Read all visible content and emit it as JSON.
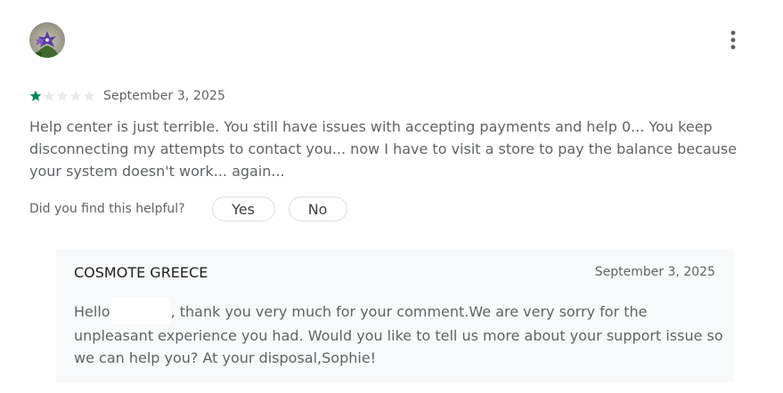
{
  "review": {
    "rating": 1,
    "rating_max": 5,
    "date": "September 3, 2025",
    "text": "Help center is just terrible. You still have issues with accepting payments and help 0... You keep disconnecting my attempts to contact you... now I have to visit a store to pay the balance because your system doesn't work... again...",
    "avatar_icon": "purple-flower-avatar",
    "menu_icon": "more-vert-icon"
  },
  "helpful": {
    "question": "Did you find this helpful?",
    "yes_label": "Yes",
    "no_label": "No"
  },
  "reply": {
    "author": "COSMOTE GREECE",
    "date": "September 3, 2025",
    "text_before": "Hello",
    "text_after": ", thank you very much for your comment.We are very sorry for the unpleasant experience you had. Would you like to tell us more about your support issue so we can help you? At your disposal,Sophie!"
  },
  "colors": {
    "star_filled": "#01875f",
    "star_empty": "#e8eaed",
    "reply_background": "#f8f9fa",
    "text": "#5f6368"
  }
}
